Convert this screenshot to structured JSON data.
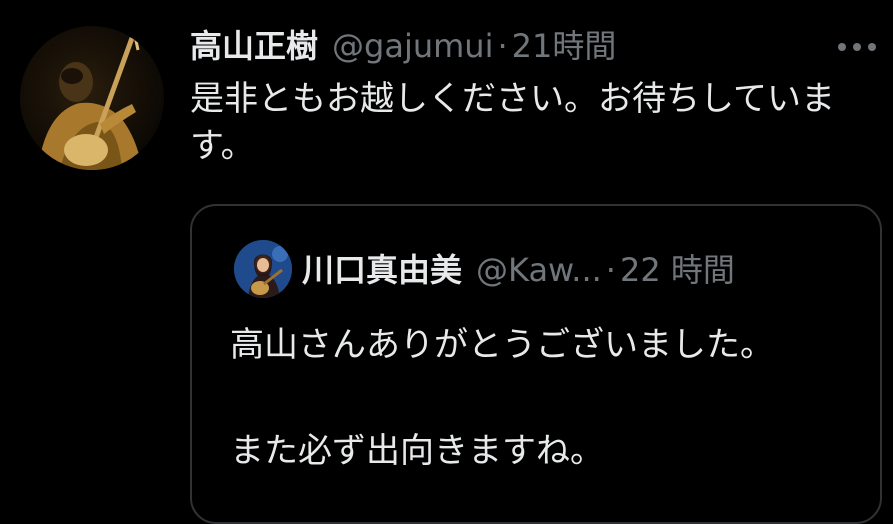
{
  "tweet": {
    "author_name": "高山正樹",
    "handle": "@gajumui",
    "separator": "·",
    "time": "21時間",
    "text": "是非ともお越しください。お待ちしています。",
    "more_icon": "more-horizontal-icon",
    "avatar": "profile-photo-musician-with-shamisen"
  },
  "quoted_tweet": {
    "author_name": "川口真由美",
    "handle": "@Kaw...",
    "separator": "·",
    "time": "22 時間",
    "text_line1": "高山さんありがとうございました。",
    "text_line2": "また必ず出向きますね。",
    "avatar": "profile-photo-singer-with-guitar"
  },
  "colors": {
    "background": "#000000",
    "primary_text": "#e7e9ea",
    "secondary_text": "#71767b",
    "border": "#2f3336"
  }
}
